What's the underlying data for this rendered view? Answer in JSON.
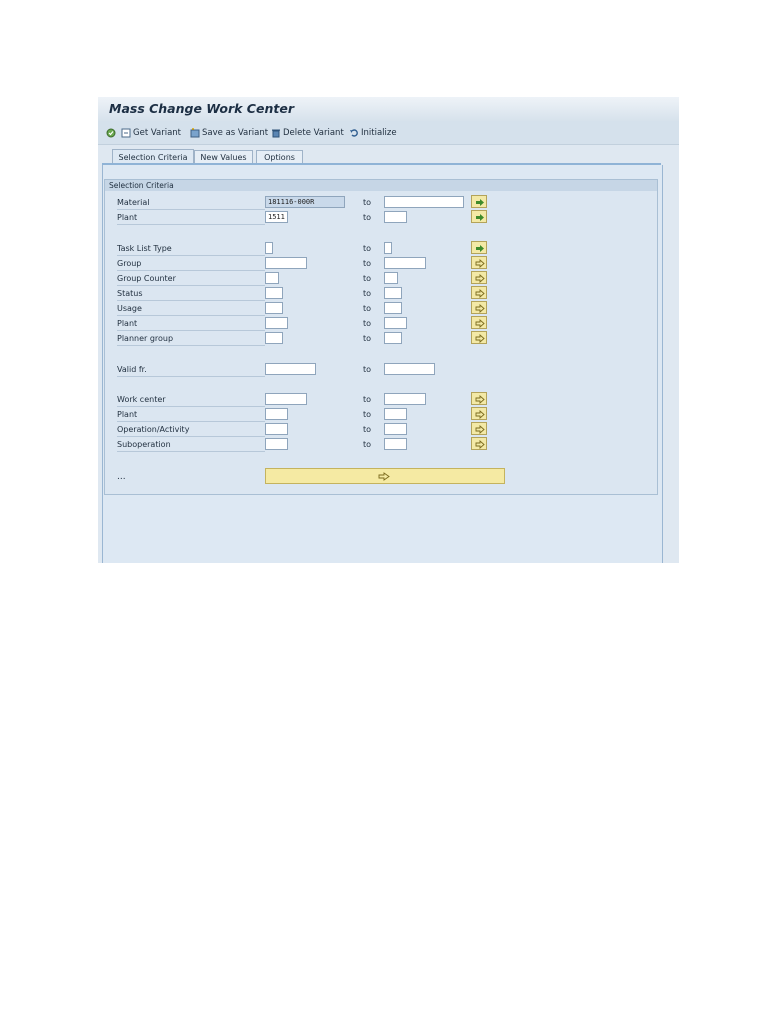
{
  "window": {
    "title": "Mass Change Work Center"
  },
  "toolbar": {
    "get_variant": "Get Variant",
    "save_as_variant": "Save as Variant",
    "delete_variant": "Delete Variant",
    "initialize": "Initialize"
  },
  "tabs": [
    {
      "label": "Selection Criteria",
      "active": true
    },
    {
      "label": "New Values",
      "active": false
    },
    {
      "label": "Options",
      "active": false
    }
  ],
  "group": {
    "title": "Selection Criteria",
    "to_label": "to",
    "rows": [
      {
        "label": "Material",
        "from": "181116-000R",
        "to": ""
      },
      {
        "label": "Plant",
        "from": "1511",
        "to": ""
      },
      {
        "label": "Task List Type",
        "from": "",
        "to": ""
      },
      {
        "label": "Group",
        "from": "",
        "to": ""
      },
      {
        "label": "Group Counter",
        "from": "",
        "to": ""
      },
      {
        "label": "Status",
        "from": "",
        "to": ""
      },
      {
        "label": "Usage",
        "from": "",
        "to": ""
      },
      {
        "label": "Plant",
        "from": "",
        "to": ""
      },
      {
        "label": "Planner group",
        "from": "",
        "to": ""
      },
      {
        "label": "Valid fr.",
        "from": "",
        "to": ""
      },
      {
        "label": "Work center",
        "from": "",
        "to": ""
      },
      {
        "label": "Plant",
        "from": "",
        "to": ""
      },
      {
        "label": "Operation/Activity",
        "from": "",
        "to": ""
      },
      {
        "label": "Suboperation",
        "from": "",
        "to": ""
      }
    ],
    "more": "..."
  },
  "colors": {
    "accent": "#8fb3d6",
    "button_yellow": "#f3e9a6"
  }
}
